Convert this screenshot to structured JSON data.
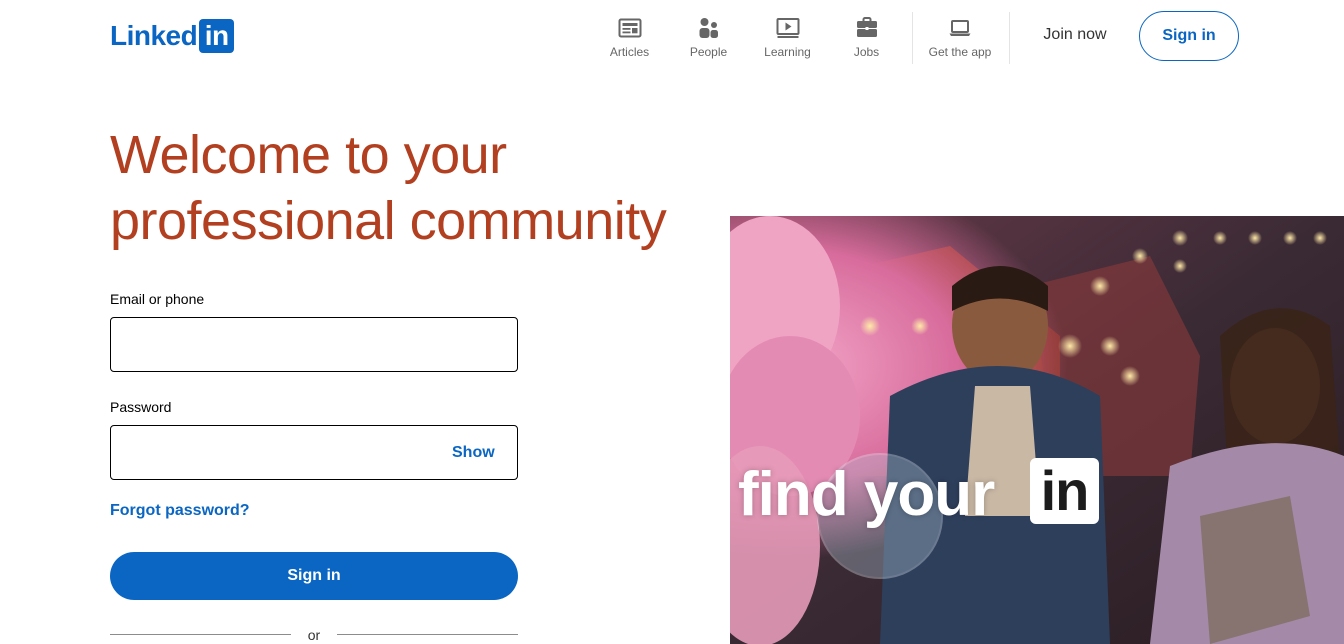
{
  "brand": {
    "logo_text": "Linked",
    "logo_box_text": "in",
    "color": "#0a66c2"
  },
  "nav": {
    "items": [
      {
        "label": "Articles",
        "icon": "articles-icon"
      },
      {
        "label": "People",
        "icon": "people-icon"
      },
      {
        "label": "Learning",
        "icon": "learning-icon"
      },
      {
        "label": "Jobs",
        "icon": "jobs-icon"
      }
    ],
    "get_app": {
      "label": "Get the app",
      "icon": "laptop-icon"
    },
    "join_now": "Join now",
    "sign_in": "Sign in"
  },
  "hero": {
    "headline_line1": "Welcome to your",
    "headline_line2": "professional community",
    "headline_color": "#b24020"
  },
  "form": {
    "email_label": "Email or phone",
    "email_value": "",
    "password_label": "Password",
    "password_value": "",
    "show_label": "Show",
    "forgot_label": "Forgot password?",
    "submit_label": "Sign in",
    "or_label": "or"
  },
  "image": {
    "overlay_text": "find your",
    "overlay_box_text": "in"
  }
}
